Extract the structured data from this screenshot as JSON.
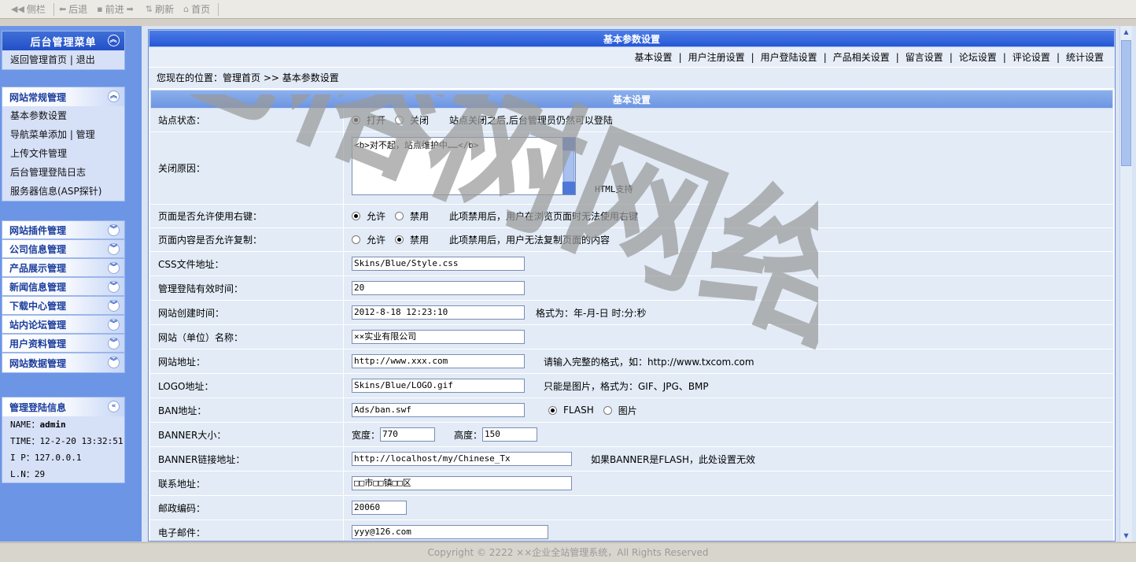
{
  "toolbar": {
    "items": [
      {
        "icon": "collapse-icon",
        "label": "侧栏"
      },
      {
        "icon": "back-icon",
        "label": "后退"
      },
      {
        "icon": "forward-icon",
        "label": "前进"
      },
      {
        "icon": "refresh-icon",
        "label": "刷新"
      },
      {
        "icon": "home-icon",
        "label": "首页"
      }
    ]
  },
  "sidebar": {
    "main": {
      "title": "后台管理菜单",
      "home_link": "返回管理首页",
      "sep": "|",
      "logout": "退出"
    },
    "general": {
      "title": "网站常规管理",
      "items": [
        "基本参数设置",
        "导航菜单添加 | 管理",
        "上传文件管理",
        "后台管理登陆日志",
        "服务器信息(ASP探针)"
      ]
    },
    "groups": [
      "网站插件管理",
      "公司信息管理",
      "产品展示管理",
      "新闻信息管理",
      "下载中心管理",
      "站内论坛管理",
      "用户资料管理",
      "网站数据管理"
    ],
    "login_info": {
      "title": "管理登陆信息",
      "lines": [
        {
          "label": "NAME：",
          "value": "admin"
        },
        {
          "label": "TIME：",
          "value": "12-2-20 13:32:51"
        },
        {
          "label": "I  P：",
          "value": "127.0.0.1"
        },
        {
          "label": "L.N：",
          "value": "29"
        }
      ]
    }
  },
  "main": {
    "title": "基本参数设置",
    "tabs": [
      "基本设置",
      "用户注册设置",
      "用户登陆设置",
      "产品相关设置",
      "留言设置",
      "论坛设置",
      "评论设置",
      "统计设置"
    ],
    "tab_sep": "|",
    "breadcrumb": "您现在的位置：管理首页 >> 基本参数设置",
    "section": "基本设置",
    "site_status": {
      "label": "站点状态：",
      "opt_on": "打开",
      "opt_off": "关闭",
      "note": "站点关闭之后,后台管理员仍然可以登陆"
    },
    "close_reason": {
      "label": "关闭原因：",
      "value": "<b>对不起，站点维护中……</b>",
      "note": "HTML支持"
    },
    "right_click": {
      "label": "页面是否允许使用右键：",
      "opt_allow": "允许",
      "opt_deny": "禁用",
      "note": "此项禁用后，用户在浏览页面时无法使用右键"
    },
    "copy": {
      "label": "页面内容是否允许复制：",
      "opt_allow": "允许",
      "opt_deny": "禁用",
      "note": "此项禁用后，用户无法复制页面的内容"
    },
    "css": {
      "label": "CSS文件地址：",
      "value": "Skins/Blue/Style.css"
    },
    "login_time": {
      "label": "管理登陆有效时间：",
      "value": "20"
    },
    "created": {
      "label": "网站创建时间：",
      "value": "2012-8-18 12:23:10",
      "note": "格式为：年-月-日 时:分:秒"
    },
    "site_name": {
      "label": "网站（单位）名称：",
      "value": "××实业有限公司"
    },
    "site_url": {
      "label": "网站地址：",
      "value": "http://www.xxx.com",
      "note": "请输入完整的格式，如：http://www.txcom.com"
    },
    "logo": {
      "label": "LOGO地址：",
      "value": "Skins/Blue/LOGO.gif",
      "note": "只能是图片，格式为：GIF、JPG、BMP"
    },
    "ban": {
      "label": "BAN地址：",
      "value": "Ads/ban.swf",
      "opt_flash": "FLASH",
      "opt_image": "图片"
    },
    "banner_size": {
      "label": "BANNER大小：",
      "width_label": "宽度：",
      "width": "770",
      "height_label": "高度：",
      "height": "150"
    },
    "banner_link": {
      "label": "BANNER链接地址：",
      "value": "http://localhost/my/Chinese_Tx",
      "note": "如果BANNER是FLASH，此处设置无效"
    },
    "address": {
      "label": "联系地址：",
      "value": "□□市□□镇□□区"
    },
    "zip": {
      "label": "邮政编码：",
      "value": "20060"
    },
    "email": {
      "label": "电子邮件：",
      "value": "yyy@126.com"
    }
  },
  "watermark": "老榕树网络",
  "footer": "Copyright © 2222 ××企业全站管理系统，All Rights Reserved",
  "colors": {
    "sidebar_bg": "#6c95e6",
    "title_bar": "#2558d6",
    "section_bar": "#7ea3e8",
    "row_bg": "#e2ebf6",
    "menu_bg": "#d6e0f7",
    "accent_text": "#1b3d9c"
  }
}
